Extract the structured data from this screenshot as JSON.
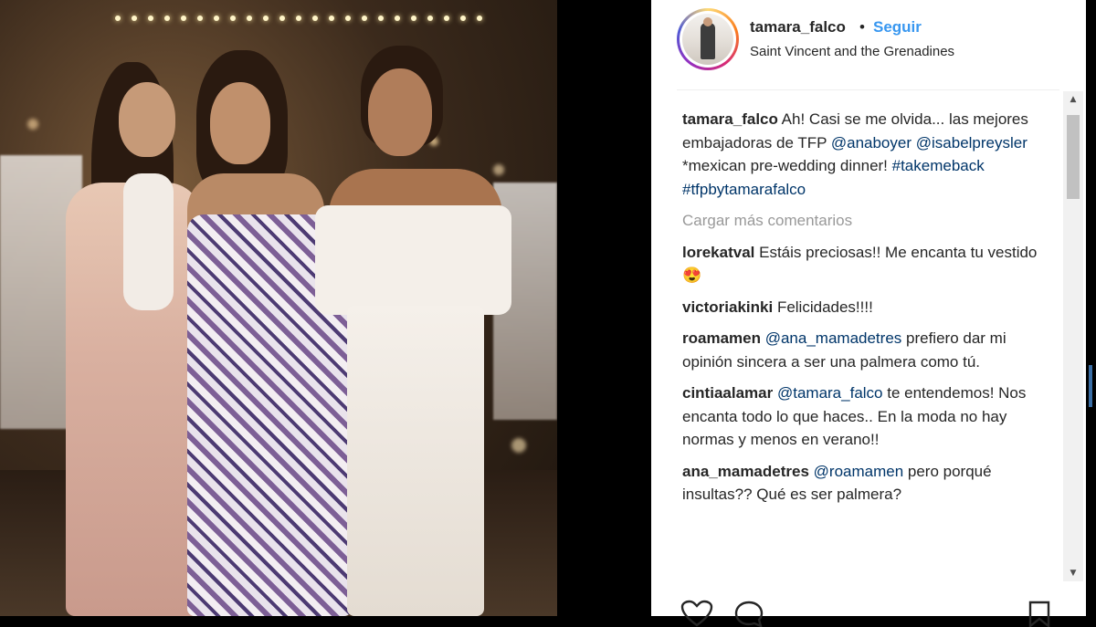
{
  "post": {
    "username": "tamara_falco",
    "separator": "•",
    "follow_label": "Seguir",
    "location": "Saint Vincent and the Grenadines"
  },
  "caption": {
    "user": "tamara_falco",
    "text_1": " Ah! Casi se me olvida... las mejores embajadoras de TFP ",
    "mention_1": "@anaboyer",
    "space": " ",
    "mention_2": "@isabelpreysler",
    "text_2": " *mexican pre-wedding dinner! ",
    "hashtag_1": "#takemeback",
    "hashtag_2": "#tfpbytamarafalco"
  },
  "load_more_label": "Cargar más comentarios",
  "comments": [
    {
      "user": "lorekatval",
      "text": " Estáis preciosas!! Me encanta tu vestido",
      "emoji": "😍"
    },
    {
      "user": "victoriakinki",
      "text": " Felicidades!!!!"
    },
    {
      "user": "roamamen",
      "mention": "@ana_mamadetres",
      "text": " prefiero dar mi opinión sincera a ser una palmera como tú."
    },
    {
      "user": "cintiaalamar",
      "mention": "@tamara_falco",
      "text": " te entendemos! Nos encanta todo lo que haces.. En la moda no hay normas y menos en verano!!"
    },
    {
      "user": "ana_mamadetres",
      "mention": "@roamamen",
      "text": " pero porqué insultas?? Qué es ser palmera?"
    }
  ],
  "icons": {
    "like": "heart-icon",
    "comment": "comment-icon",
    "save": "bookmark-icon",
    "scroll_up": "▲",
    "scroll_down": "▼"
  },
  "colors": {
    "link": "#3897f0",
    "mention": "#003569",
    "muted": "#999999",
    "text": "#262626"
  }
}
